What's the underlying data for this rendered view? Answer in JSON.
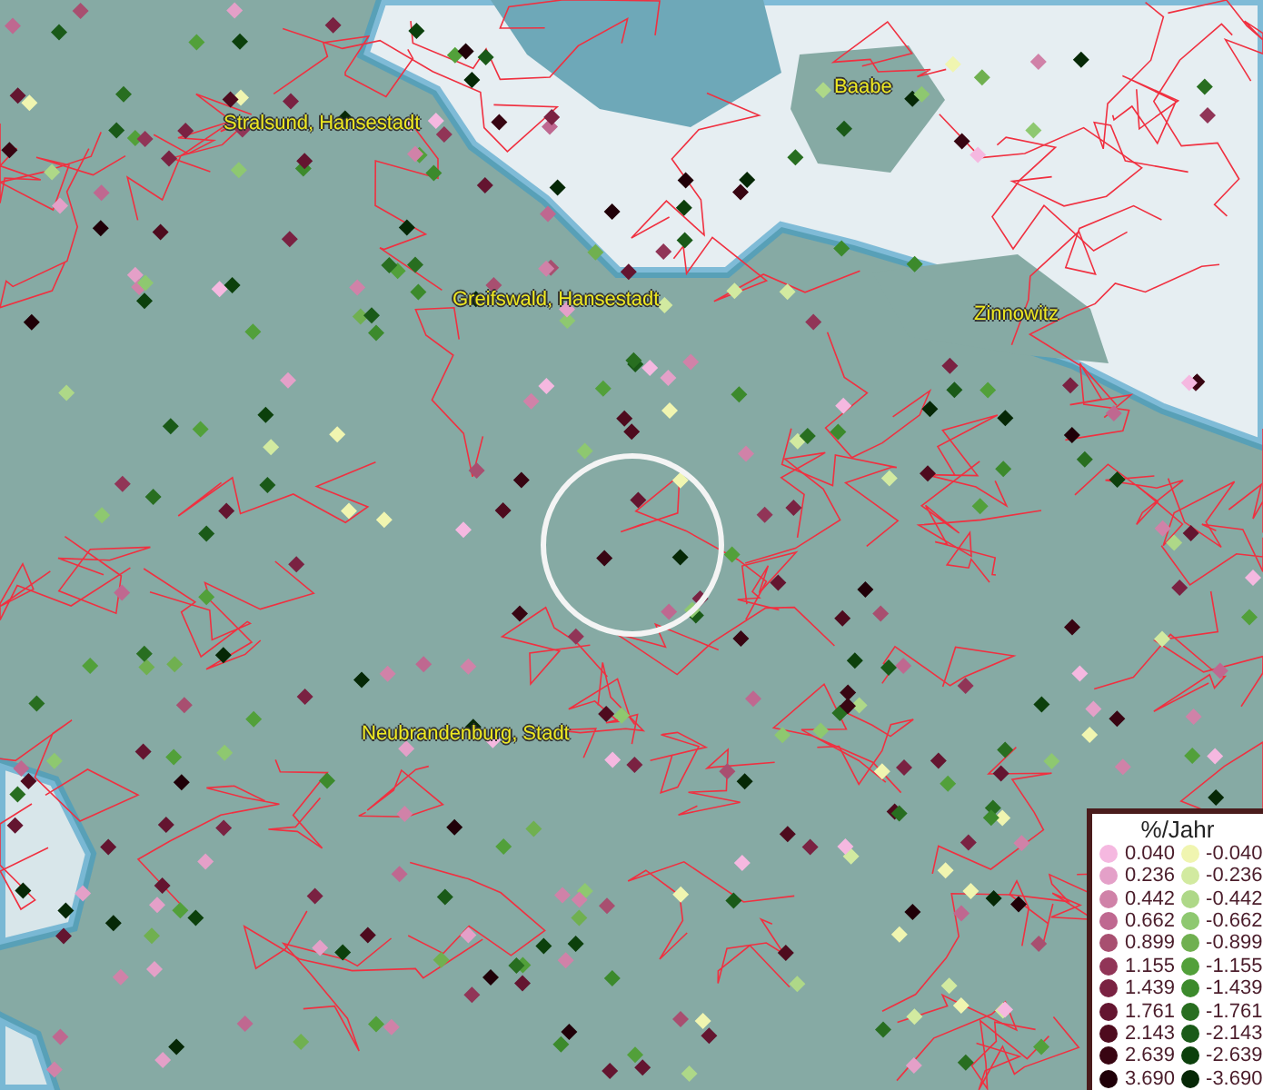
{
  "map": {
    "places": [
      {
        "name": "Baabe"
      },
      {
        "name": "Stralsund, Hansestadt"
      },
      {
        "name": "Greifswald, Hansestadt"
      },
      {
        "name": "Zinnowitz"
      },
      {
        "name": "Neubrandenburg, Stadt"
      }
    ]
  },
  "legend": {
    "title": "%/Jahr",
    "columns": [
      [
        {
          "label": "0.040",
          "color": "#f5b8e0"
        },
        {
          "label": "0.236",
          "color": "#e4a0c8"
        },
        {
          "label": "0.442",
          "color": "#d082a8"
        },
        {
          "label": "0.662",
          "color": "#bf6890"
        },
        {
          "label": "0.899",
          "color": "#a84f70"
        },
        {
          "label": "1.155",
          "color": "#913557"
        },
        {
          "label": "1.439",
          "color": "#7a2242"
        },
        {
          "label": "1.761",
          "color": "#641530"
        },
        {
          "label": "2.143",
          "color": "#4e0b1e"
        },
        {
          "label": "2.639",
          "color": "#380512"
        },
        {
          "label": "3.690",
          "color": "#200008"
        }
      ],
      [
        {
          "label": "-0.040",
          "color": "#f0f5b0"
        },
        {
          "label": "-0.236",
          "color": "#d2eaa0"
        },
        {
          "label": "-0.442",
          "color": "#aed888"
        },
        {
          "label": "-0.662",
          "color": "#8ec870"
        },
        {
          "label": "-0.899",
          "color": "#70b050"
        },
        {
          "label": "-1.155",
          "color": "#52a03a"
        },
        {
          "label": "-1.439",
          "color": "#3c8a2c"
        },
        {
          "label": "-1.761",
          "color": "#286e20"
        },
        {
          "label": "-2.143",
          "color": "#1a5a18"
        },
        {
          "label": "-2.639",
          "color": "#0c400c"
        },
        {
          "label": "-3.690",
          "color": "#062806"
        }
      ]
    ]
  }
}
